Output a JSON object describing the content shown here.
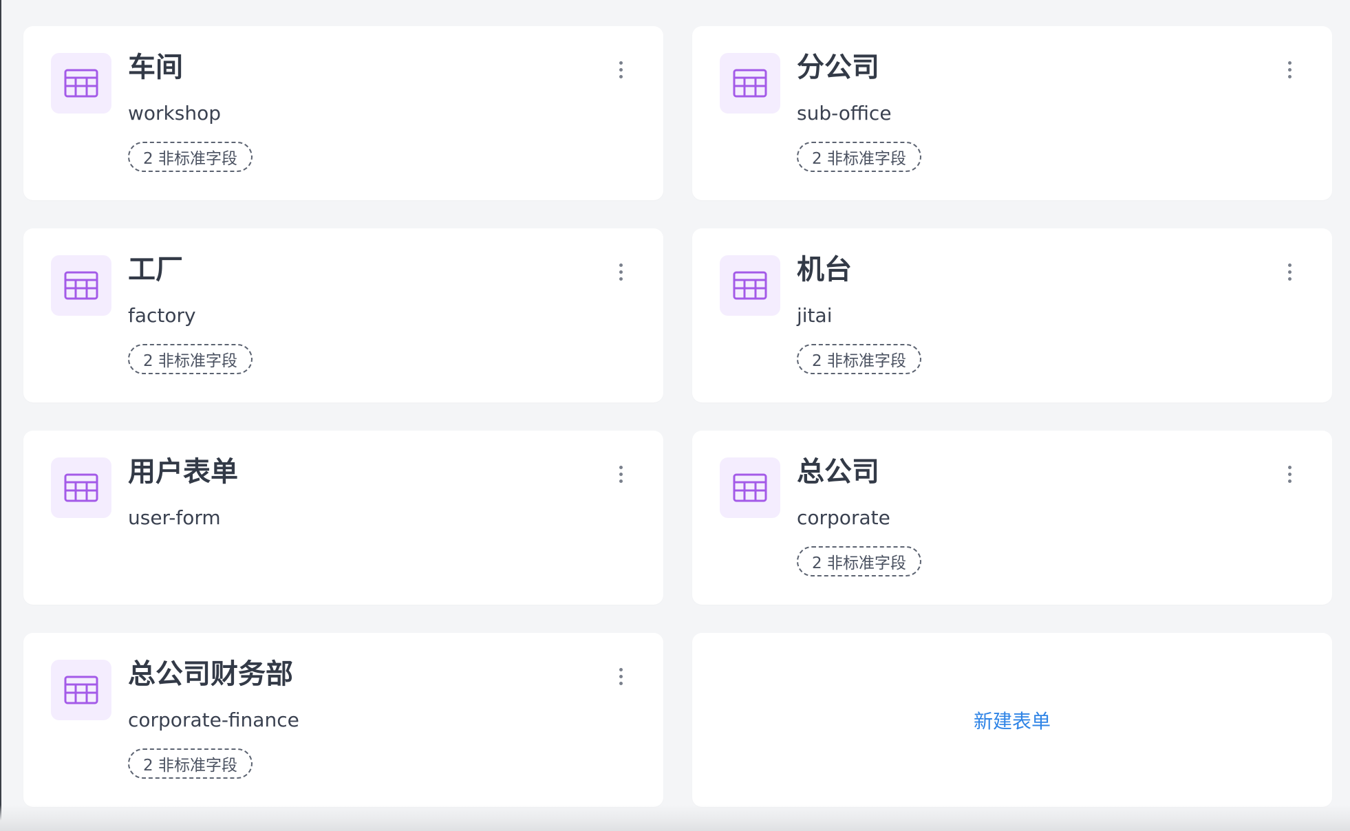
{
  "forms": [
    {
      "title": "车间",
      "key": "workshop",
      "badge": "2 非标准字段"
    },
    {
      "title": "分公司",
      "key": "sub-office",
      "badge": "2 非标准字段"
    },
    {
      "title": "工厂",
      "key": "factory",
      "badge": "2 非标准字段"
    },
    {
      "title": "机台",
      "key": "jitai",
      "badge": "2 非标准字段"
    },
    {
      "title": "用户表单",
      "key": "user-form",
      "badge": ""
    },
    {
      "title": "总公司",
      "key": "corporate",
      "badge": "2 非标准字段"
    },
    {
      "title": "总公司财务部",
      "key": "corporate-finance",
      "badge": "2 非标准字段"
    }
  ],
  "new_form": {
    "label": "新建表单"
  },
  "icons": {
    "form": "table-icon",
    "more": "more-vertical-icon"
  },
  "colors": {
    "accent": "#a35ae8",
    "icon_bg": "#f4edfe",
    "link": "#2f84e6"
  }
}
